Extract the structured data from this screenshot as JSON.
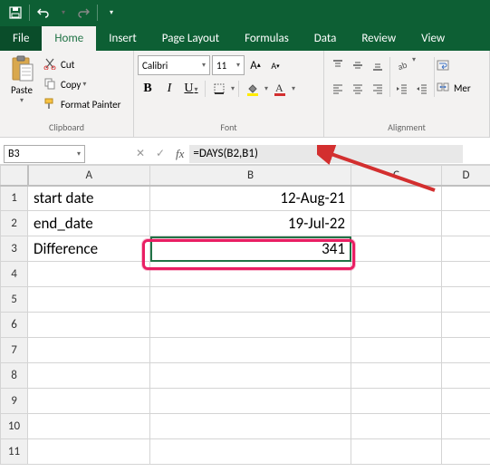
{
  "qat": {
    "save": "save",
    "undo": "undo",
    "redo": "redo"
  },
  "menu": {
    "file": "File",
    "home": "Home",
    "insert": "Insert",
    "page_layout": "Page Layout",
    "formulas": "Formulas",
    "data": "Data",
    "review": "Review",
    "view": "View"
  },
  "ribbon": {
    "clipboard": {
      "paste": "Paste",
      "cut": "Cut",
      "copy": "Copy",
      "format_painter": "Format Painter",
      "label": "Clipboard"
    },
    "font": {
      "name": "Calibri",
      "size": "11",
      "bold": "B",
      "italic": "I",
      "underline": "U",
      "label": "Font"
    },
    "alignment": {
      "merge": "Mer",
      "label": "Alignment"
    }
  },
  "name_box": "B3",
  "formula": "=DAYS(B2,B1)",
  "columns": [
    "A",
    "B",
    "C",
    "D"
  ],
  "rows": [
    "1",
    "2",
    "3",
    "4",
    "5",
    "6",
    "7",
    "8",
    "9",
    "10",
    "11"
  ],
  "cells": {
    "a1": "start date",
    "b1": "12-Aug-21",
    "a2": "end_date",
    "b2": "19-Jul-22",
    "a3": "Difference",
    "b3": "341"
  }
}
